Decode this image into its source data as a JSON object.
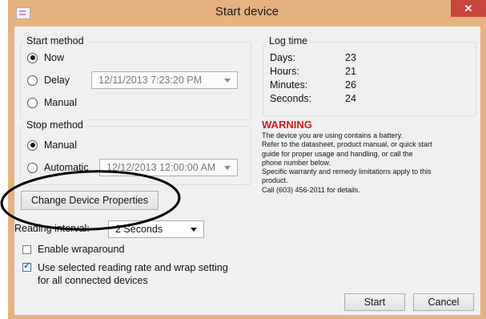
{
  "window": {
    "title": "Start device",
    "close_glyph": "✕"
  },
  "start_method": {
    "legend": "Start method",
    "options": [
      {
        "label": "Now",
        "selected": true
      },
      {
        "label": "Delay",
        "selected": false
      },
      {
        "label": "Manual",
        "selected": false
      }
    ],
    "delay_datetime": "12/11/2013 7:23:20 PM"
  },
  "stop_method": {
    "legend": "Stop method",
    "options": [
      {
        "label": "Manual",
        "selected": true
      },
      {
        "label": "Automatic",
        "selected": false
      }
    ],
    "auto_datetime": "12/12/2013 12:00:00 AM"
  },
  "log_time": {
    "legend": "Log time",
    "rows": [
      {
        "label": "Days:",
        "value": "23"
      },
      {
        "label": "Hours:",
        "value": "21"
      },
      {
        "label": "Minutes:",
        "value": "26"
      },
      {
        "label": "Seconds:",
        "value": "24"
      }
    ]
  },
  "warning": {
    "title": "WARNING",
    "lines": [
      "The device you are using contains a battery.",
      "Refer to the datasheet, product manual, or quick start",
      "guide for proper usage and handling, or call the",
      "phone number below.",
      "Specific warranty and remedy limitations apply to this",
      "product.",
      "Call (603) 456-2011 for details."
    ]
  },
  "change_props_label": "Change Device Properties",
  "reading_interval": {
    "label": "Reading interval:",
    "value": "2 Seconds"
  },
  "enable_wraparound": {
    "label": "Enable wraparound",
    "checked": false
  },
  "apply_all": {
    "label_line1": "Use selected reading rate and wrap setting",
    "label_line2": "for all connected devices",
    "checked": true
  },
  "buttons": {
    "start": "Start",
    "cancel": "Cancel"
  },
  "colors": {
    "frame": "#e6b27f",
    "close": "#c7463d",
    "warning": "#d01c1c",
    "annotation": "#000000"
  }
}
